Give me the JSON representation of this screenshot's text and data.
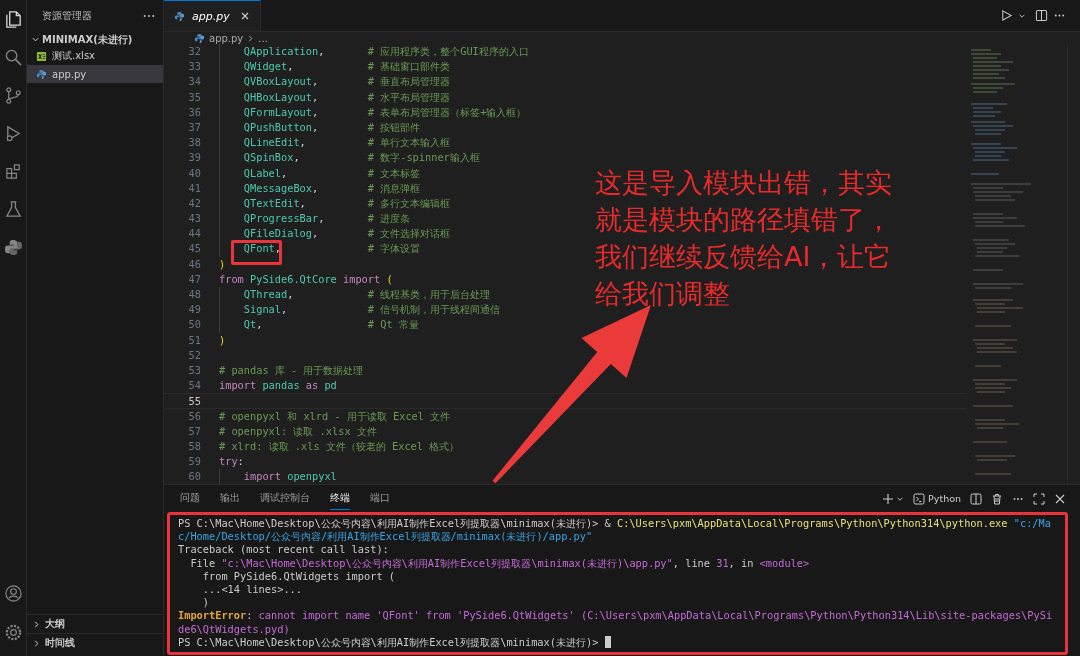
{
  "activity_bar": [
    {
      "kind": "files",
      "selected": true
    },
    {
      "kind": "search",
      "selected": false
    },
    {
      "kind": "branch",
      "selected": false
    },
    {
      "kind": "debug",
      "selected": false
    },
    {
      "kind": "extensions",
      "selected": false
    },
    {
      "kind": "flask",
      "selected": false
    },
    {
      "kind": "python",
      "selected": false
    }
  ],
  "activity_bar_bottom": [
    {
      "kind": "account"
    },
    {
      "kind": "settings"
    }
  ],
  "sidebar": {
    "title": "资源管理器",
    "folder": {
      "name": "MINIMAX(未进行)",
      "expanded": true,
      "children": [
        {
          "name": "测试.xlsx",
          "kind": "excel",
          "selected": false
        },
        {
          "name": "app.py",
          "kind": "python",
          "selected": true
        }
      ]
    },
    "sections": [
      {
        "name": "大纲",
        "expanded": false
      },
      {
        "name": "时间线",
        "expanded": false
      }
    ]
  },
  "editor": {
    "tabs": [
      {
        "label": "app.py",
        "selected": true
      }
    ],
    "breadcrumb": [
      "app.py",
      "..."
    ],
    "code_lines": [
      {
        "number": "32",
        "indented": true,
        "current": false,
        "tokens": [
          {
            "text": "QApplication",
            "kind": "class"
          },
          {
            "text": ",",
            "kind": "plain"
          }
        ],
        "comment": "# 应用程序类，整个GUI程序的入口"
      },
      {
        "number": "33",
        "indented": true,
        "current": false,
        "tokens": [
          {
            "text": "QWidget",
            "kind": "class"
          },
          {
            "text": ",",
            "kind": "plain"
          }
        ],
        "comment": "# 基础窗口部件类"
      },
      {
        "number": "34",
        "indented": true,
        "current": false,
        "tokens": [
          {
            "text": "QVBoxLayout",
            "kind": "class"
          },
          {
            "text": ",",
            "kind": "plain"
          }
        ],
        "comment": "# 垂直布局管理器"
      },
      {
        "number": "35",
        "indented": true,
        "current": false,
        "tokens": [
          {
            "text": "QHBoxLayout",
            "kind": "class"
          },
          {
            "text": ",",
            "kind": "plain"
          }
        ],
        "comment": "# 水平布局管理器"
      },
      {
        "number": "36",
        "indented": true,
        "current": false,
        "tokens": [
          {
            "text": "QFormLayout",
            "kind": "class"
          },
          {
            "text": ",",
            "kind": "plain"
          }
        ],
        "comment": "# 表单布局管理器（标签+输入框）"
      },
      {
        "number": "37",
        "indented": true,
        "current": false,
        "tokens": [
          {
            "text": "QPushButton",
            "kind": "class"
          },
          {
            "text": ",",
            "kind": "plain"
          }
        ],
        "comment": "# 按钮部件"
      },
      {
        "number": "38",
        "indented": true,
        "current": false,
        "tokens": [
          {
            "text": "QLineEdit",
            "kind": "class"
          },
          {
            "text": ",",
            "kind": "plain"
          }
        ],
        "comment": "# 单行文本输入框"
      },
      {
        "number": "39",
        "indented": true,
        "current": false,
        "tokens": [
          {
            "text": "QSpinBox",
            "kind": "class"
          },
          {
            "text": ",",
            "kind": "plain"
          }
        ],
        "comment": "# 数字-spinner输入框"
      },
      {
        "number": "40",
        "indented": true,
        "current": false,
        "tokens": [
          {
            "text": "QLabel",
            "kind": "class"
          },
          {
            "text": ",",
            "kind": "plain"
          }
        ],
        "comment": "# 文本标签"
      },
      {
        "number": "41",
        "indented": true,
        "current": false,
        "tokens": [
          {
            "text": "QMessageBox",
            "kind": "class"
          },
          {
            "text": ",",
            "kind": "plain"
          }
        ],
        "comment": "# 消息弹框"
      },
      {
        "number": "42",
        "indented": true,
        "current": false,
        "tokens": [
          {
            "text": "QTextEdit",
            "kind": "class"
          },
          {
            "text": ",",
            "kind": "plain"
          }
        ],
        "comment": "# 多行文本编辑框"
      },
      {
        "number": "43",
        "indented": true,
        "current": false,
        "tokens": [
          {
            "text": "QProgressBar",
            "kind": "class"
          },
          {
            "text": ",",
            "kind": "plain"
          }
        ],
        "comment": "# 进度条"
      },
      {
        "number": "44",
        "indented": true,
        "current": false,
        "tokens": [
          {
            "text": "QFileDialog",
            "kind": "class"
          },
          {
            "text": ",",
            "kind": "plain"
          }
        ],
        "comment": "# 文件选择对话框"
      },
      {
        "number": "45",
        "indented": true,
        "current": false,
        "annotated": true,
        "tokens": [
          {
            "text": "QFont",
            "kind": "class"
          },
          {
            "text": ",",
            "kind": "plain"
          }
        ],
        "comment": "# 字体设置"
      },
      {
        "number": "46",
        "indented": false,
        "current": false,
        "tokens": [
          {
            "text": ")",
            "kind": "paren"
          }
        ]
      },
      {
        "number": "47",
        "indented": false,
        "current": false,
        "tokens": [
          {
            "text": "from",
            "kind": "keyword"
          },
          {
            "text": " PySide6.QtCore ",
            "kind": "module"
          },
          {
            "text": "import",
            "kind": "keyword"
          },
          {
            "text": " (",
            "kind": "paren"
          }
        ]
      },
      {
        "number": "48",
        "indented": true,
        "current": false,
        "tokens": [
          {
            "text": "QThread",
            "kind": "class"
          },
          {
            "text": ",",
            "kind": "plain"
          }
        ],
        "comment": "# 线程基类，用于后台处理"
      },
      {
        "number": "49",
        "indented": true,
        "current": false,
        "tokens": [
          {
            "text": "Signal",
            "kind": "class"
          },
          {
            "text": ",",
            "kind": "plain"
          }
        ],
        "comment": "# 信号机制，用于线程间通信"
      },
      {
        "number": "50",
        "indented": true,
        "current": false,
        "tokens": [
          {
            "text": "Qt",
            "kind": "class"
          },
          {
            "text": ",",
            "kind": "plain"
          }
        ],
        "comment": "# Qt 常量"
      },
      {
        "number": "51",
        "indented": false,
        "current": false,
        "tokens": [
          {
            "text": ")",
            "kind": "paren"
          }
        ]
      },
      {
        "number": "52",
        "current": false
      },
      {
        "number": "53",
        "indented": false,
        "current": false,
        "comment": "# pandas 库 - 用于数据处理"
      },
      {
        "number": "54",
        "indented": false,
        "current": false,
        "tokens": [
          {
            "text": "import",
            "kind": "keyword"
          },
          {
            "text": " pandas ",
            "kind": "module"
          },
          {
            "text": "as",
            "kind": "keyword"
          },
          {
            "text": " pd",
            "kind": "module"
          }
        ]
      },
      {
        "number": "55",
        "current": true
      },
      {
        "number": "56",
        "indented": false,
        "current": false,
        "comment": "# openpyxl 和 xlrd - 用于读取 Excel 文件"
      },
      {
        "number": "57",
        "indented": false,
        "current": false,
        "comment": "# openpyxl: 读取 .xlsx 文件"
      },
      {
        "number": "58",
        "indented": false,
        "current": false,
        "comment": "# xlrd: 读取 .xls 文件（较老的 Excel 格式）"
      },
      {
        "number": "59",
        "indented": false,
        "current": false,
        "tokens": [
          {
            "text": "try",
            "kind": "keyword"
          },
          {
            "text": ":",
            "kind": "plain"
          }
        ]
      },
      {
        "number": "60",
        "indented": true,
        "current": false,
        "tokens": [
          {
            "text": "import",
            "kind": "keyword"
          },
          {
            "text": " openpyxl",
            "kind": "module"
          }
        ]
      }
    ]
  },
  "panel": {
    "tabs": [
      {
        "label": "问题",
        "selected": false
      },
      {
        "label": "输出",
        "selected": false
      },
      {
        "label": "调试控制台",
        "selected": false
      },
      {
        "label": "终端",
        "selected": true
      },
      {
        "label": "端口",
        "selected": false
      }
    ],
    "terminal_profile": "Python",
    "annotated": true,
    "terminal_lines": [
      [
        {
          "text": "PS C:\\Mac\\Home\\Desktop\\公众号内容\\利用AI制作Excel列提取器\\minimax(未进行)> & ",
          "kind": "plain"
        },
        {
          "text": "C:\\Users\\pxm\\AppData\\Local\\Programs\\Python\\Python314\\python.exe",
          "kind": "exe"
        },
        {
          "text": " \"c:/Mac/Home/Desktop/公众号内容/利用AI制作Excel列提取器/minimax(未进行)/app.py\"",
          "kind": "string"
        }
      ],
      [
        {
          "text": "Traceback (most recent call last):",
          "kind": "plain"
        }
      ],
      [
        {
          "text": "  File ",
          "kind": "plain"
        },
        {
          "text": "\"c:\\Mac\\Home\\Desktop\\公众号内容\\利用AI制作Excel列提取器\\minimax(未进行)\\app.py\"",
          "kind": "path"
        },
        {
          "text": ", line ",
          "kind": "plain"
        },
        {
          "text": "31",
          "kind": "path"
        },
        {
          "text": ", in ",
          "kind": "plain"
        },
        {
          "text": "<module>",
          "kind": "path"
        }
      ],
      [
        {
          "text": "    from PySide6.QtWidgets import (",
          "kind": "plain"
        }
      ],
      [
        {
          "text": "    ...<14 lines>...",
          "kind": "plain"
        }
      ],
      [
        {
          "text": "    )",
          "kind": "plain"
        }
      ],
      [
        {
          "text": "ImportError",
          "kind": "error"
        },
        {
          "text": ": ",
          "kind": "plain"
        },
        {
          "text": "cannot import name 'QFont' from 'PySide6.QtWidgets' (C:\\Users\\pxm\\AppData\\Local\\Programs\\Python\\Python314\\Lib\\site-packages\\PySide6\\QtWidgets.pyd)",
          "kind": "message"
        }
      ],
      [
        {
          "text": "PS C:\\Mac\\Home\\Desktop\\公众号内容\\利用AI制作Excel列提取器\\minimax(未进行)> ",
          "kind": "plain"
        }
      ]
    ]
  },
  "annotation": {
    "text": "这是导入模块出错，其实就是模块的路径填错了，我们继续反馈给AI，让它给我们调整"
  }
}
